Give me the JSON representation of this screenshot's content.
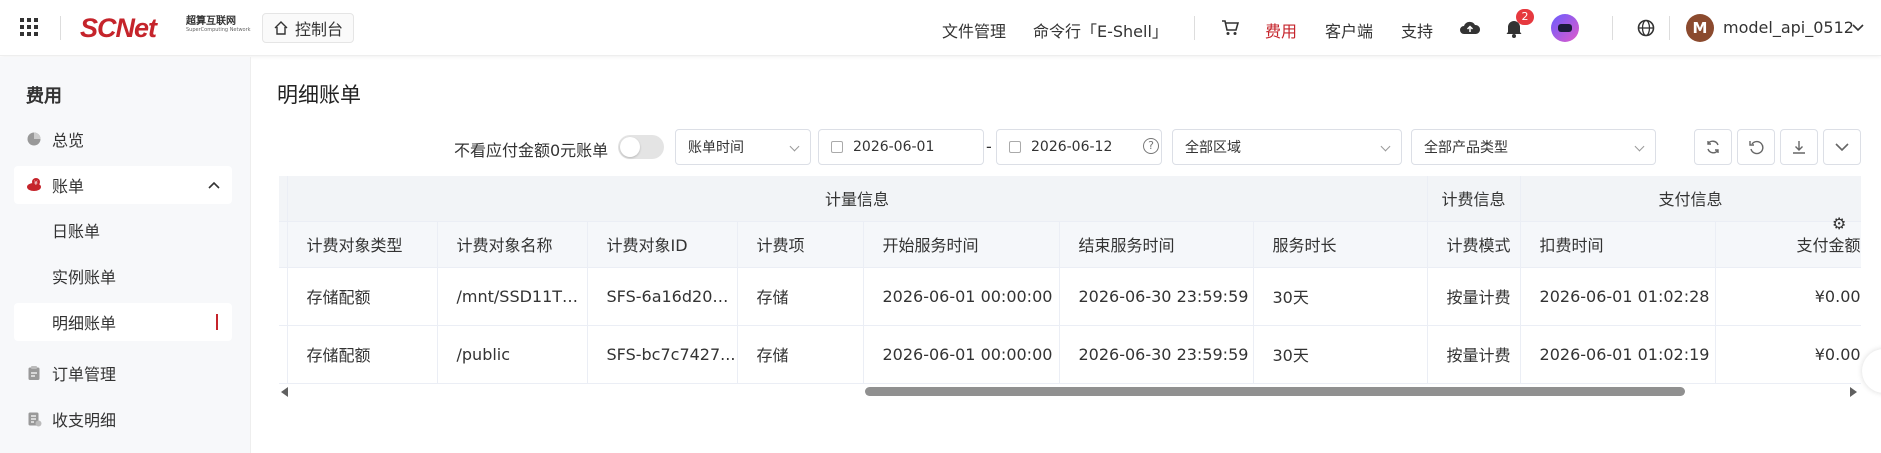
{
  "header": {
    "logo_text": "SCNet",
    "logo_cn": "超算互联网",
    "logo_en": "SuperComputing Network",
    "console_label": "控制台",
    "nav": [
      "文件管理",
      "命令行「E-Shell」"
    ],
    "fee_label": "费用",
    "client_label": "客户端",
    "support_label": "支持",
    "notification_count": "2",
    "user_initial": "M",
    "username": "model_api_0512",
    "accent_color": "#c5242b"
  },
  "sidebar": {
    "title": "费用",
    "items": [
      {
        "label": "总览",
        "icon": "pie-chart-icon"
      },
      {
        "label": "账单",
        "icon": "bill-icon"
      },
      {
        "label": "日账单"
      },
      {
        "label": "实例账单"
      },
      {
        "label": "明细账单"
      },
      {
        "label": "订单管理",
        "icon": "clipboard-icon"
      },
      {
        "label": "收支明细",
        "icon": "ledger-icon"
      }
    ]
  },
  "main": {
    "title": "明细账单",
    "filter_zero_label": "不看应付金额0元账单",
    "time_select": "账单时间",
    "date_start": "2026-06-01",
    "date_separator": "-",
    "date_end": "2026-06-12",
    "region_select": "全部区域",
    "product_select": "全部产品类型"
  },
  "table": {
    "groups": [
      "计量信息",
      "计费信息",
      "支付信息"
    ],
    "columns": [
      "计费对象类型",
      "计费对象名称",
      "计费对象ID",
      "计费项",
      "开始服务时间",
      "结束服务时间",
      "服务时长",
      "计费模式",
      "扣费时间",
      "支付金额"
    ],
    "rows": [
      [
        "存储配额",
        "/mnt/SSD11T2...",
        "SFS-6a16d208...",
        "存储",
        "2026-06-01 00:00:00",
        "2026-06-30 23:59:59",
        "30天",
        "按量计费",
        "2026-06-01 01:02:28",
        "¥0.00"
      ],
      [
        "存储配额",
        "/public",
        "SFS-bc7c7427...",
        "存储",
        "2026-06-01 00:00:00",
        "2026-06-30 23:59:59",
        "30天",
        "按量计费",
        "2026-06-01 01:02:19",
        "¥0.00"
      ]
    ]
  }
}
